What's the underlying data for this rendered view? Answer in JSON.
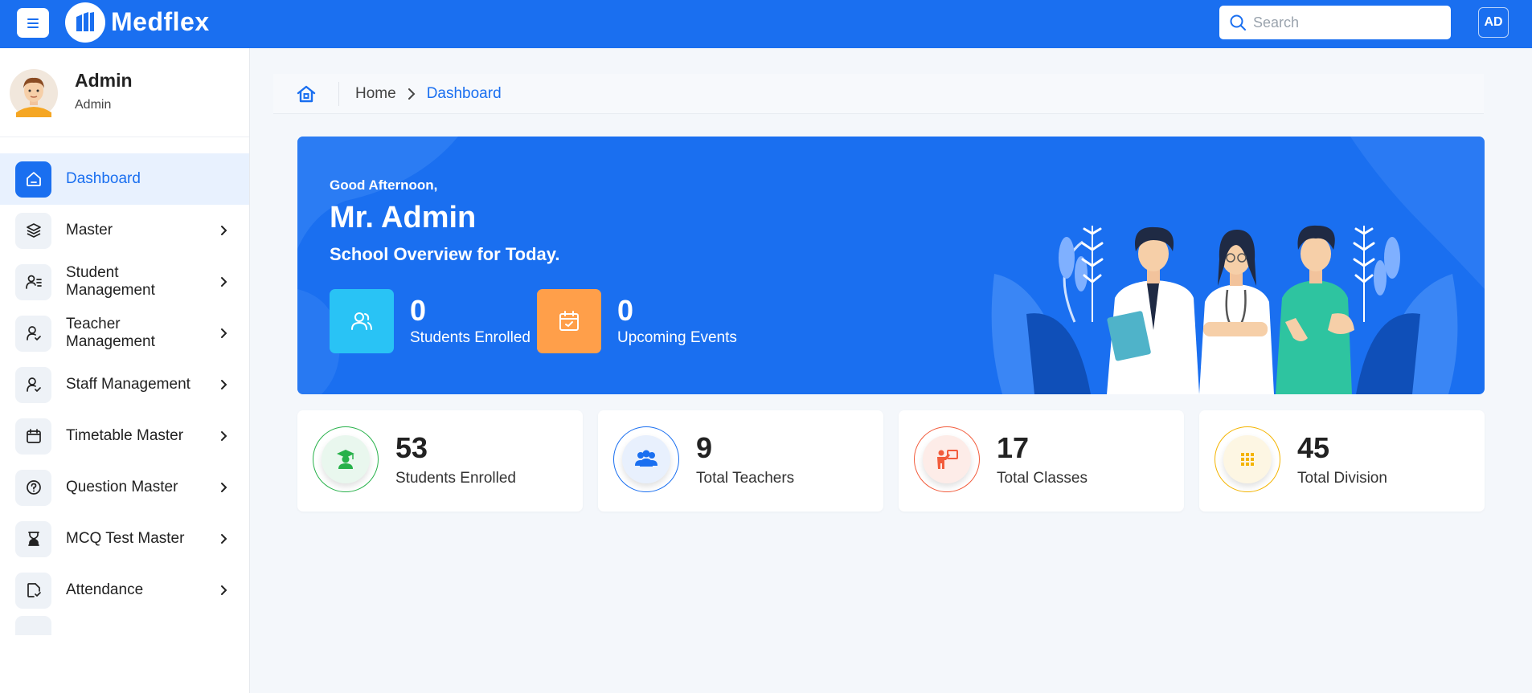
{
  "app": {
    "name": "Medflex"
  },
  "header": {
    "search_placeholder": "Search",
    "user_initials": "AD"
  },
  "profile": {
    "name": "Admin",
    "role": "Admin"
  },
  "sidebar": {
    "items": [
      {
        "label": "Dashboard",
        "icon": "home-icon",
        "active": true,
        "has_arrow": false
      },
      {
        "label": "Master",
        "icon": "layers-icon",
        "has_arrow": true
      },
      {
        "label": "Student Management",
        "icon": "user-list-icon",
        "has_arrow": true
      },
      {
        "label": "Teacher Management",
        "icon": "user-check-icon",
        "has_arrow": true
      },
      {
        "label": "Staff Management",
        "icon": "user-check-icon",
        "has_arrow": true
      },
      {
        "label": "Timetable Master",
        "icon": "calendar-icon",
        "has_arrow": true
      },
      {
        "label": "Question Master",
        "icon": "help-circle-icon",
        "has_arrow": true
      },
      {
        "label": "MCQ Test Master",
        "icon": "hourglass-icon",
        "has_arrow": true
      },
      {
        "label": "Attendance",
        "icon": "file-check-icon",
        "has_arrow": true
      }
    ]
  },
  "breadcrumb": {
    "home": "Home",
    "current": "Dashboard"
  },
  "hero": {
    "greeting": "Good Afternoon,",
    "name": "Mr. Admin",
    "subtitle": "School Overview for Today.",
    "stats": [
      {
        "value": "0",
        "label": "Students Enrolled",
        "color": "#29c3f5",
        "icon": "users-icon"
      },
      {
        "value": "0",
        "label": "Upcoming Events",
        "color": "#ff9f4a",
        "icon": "calendar-icon"
      }
    ]
  },
  "cards": [
    {
      "value": "53",
      "label": "Students Enrolled",
      "color": "#27b14a",
      "icon": "graduate-icon"
    },
    {
      "value": "9",
      "label": "Total Teachers",
      "color": "#1a6ff0",
      "icon": "group-icon"
    },
    {
      "value": "17",
      "label": "Total Classes",
      "color": "#f25c3c",
      "icon": "teacher-board-icon"
    },
    {
      "value": "45",
      "label": "Total Division",
      "color": "#f4b400",
      "icon": "grid-icon"
    }
  ],
  "colors": {
    "primary": "#1a6ff0",
    "sidebar_active_bg": "#e8f1fe"
  }
}
